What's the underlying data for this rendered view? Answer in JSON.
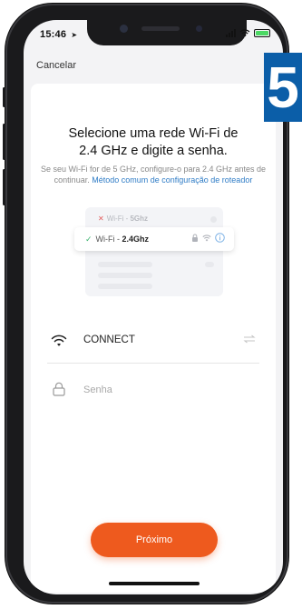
{
  "status_bar": {
    "time": "15:46",
    "battery_color": "#4cd964"
  },
  "nav": {
    "cancel_label": "Cancelar"
  },
  "header": {
    "title_line1": "Selecione uma rede Wi-Fi de",
    "title_line2": "2.4 GHz e digite a senha.",
    "subtitle_text": "Se seu Wi-Fi for de 5 GHz, configure-o para 2.4 GHz antes de continuar.",
    "subtitle_link": "Método comum de configuração de roteador"
  },
  "illustration": {
    "row_5ghz_prefix": "Wi-Fi - ",
    "row_5ghz_band": "5Ghz",
    "row_24ghz_prefix": "Wi-Fi - ",
    "row_24ghz_band": "2.4Ghz"
  },
  "form": {
    "wifi_name": "CONNECT",
    "password_placeholder": "Senha"
  },
  "actions": {
    "next_label": "Próximo"
  },
  "step_badge": "5",
  "colors": {
    "accent": "#ee5a1e",
    "link": "#2f7cc6",
    "badge": "#0b5ea8",
    "check": "#3bb36e",
    "cross": "#e35b5b"
  }
}
